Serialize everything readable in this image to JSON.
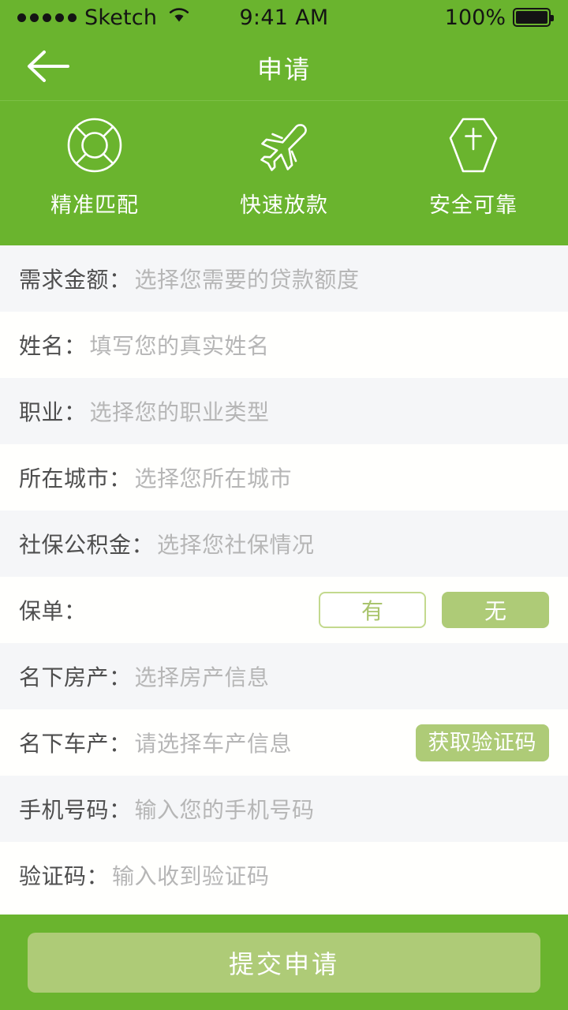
{
  "status_bar": {
    "carrier": "Sketch",
    "time": "9:41 AM",
    "battery_percent": "100%",
    "signal_dots": 5,
    "wifi_icon": "wifi-icon",
    "battery_icon": "battery-full-icon"
  },
  "nav": {
    "title": "申请",
    "back_icon": "arrow-left-icon"
  },
  "features": [
    {
      "label": "精准匹配",
      "icon": "lifebuoy-icon"
    },
    {
      "label": "快速放款",
      "icon": "airplane-icon"
    },
    {
      "label": "安全可靠",
      "icon": "shield-cross-icon"
    }
  ],
  "form": {
    "rows": [
      {
        "label": "需求金额：",
        "placeholder": "选择您需要的贷款额度",
        "type": "select",
        "shade": "alt"
      },
      {
        "label": "姓名：",
        "placeholder": "填写您的真实姓名",
        "type": "text",
        "shade": "base"
      },
      {
        "label": "职业：",
        "placeholder": "选择您的职业类型",
        "type": "select",
        "shade": "alt"
      },
      {
        "label": "所在城市：",
        "placeholder": "选择您所在城市",
        "type": "select",
        "shade": "base"
      },
      {
        "label": "社保公积金：",
        "placeholder": "选择您社保情况",
        "type": "select",
        "shade": "alt"
      },
      {
        "label": "保单：",
        "placeholder": "",
        "type": "toggle",
        "shade": "base"
      },
      {
        "label": "名下房产：",
        "placeholder": "选择房产信息",
        "type": "select",
        "shade": "alt"
      },
      {
        "label": "名下车产：",
        "placeholder": "请选择车产信息",
        "type": "action",
        "shade": "base"
      },
      {
        "label": "手机号码：",
        "placeholder": "输入您的手机号码",
        "type": "text",
        "shade": "alt"
      },
      {
        "label": "验证码：",
        "placeholder": "输入收到验证码",
        "type": "text",
        "shade": "base"
      }
    ],
    "toggle_options": [
      {
        "label": "有",
        "selected": false
      },
      {
        "label": "无",
        "selected": true
      }
    ],
    "get_code_label": "获取验证码"
  },
  "footer": {
    "submit_label": "提交申请"
  },
  "colors": {
    "brand_green": "#6ab42e",
    "button_green": "#aecb77",
    "toggle_border": "#c3d98e",
    "row_alt": "#f5f6f8",
    "row_base": "#fffffd",
    "label_text": "#4e4e4e",
    "placeholder_text": "#b6b6b6"
  }
}
